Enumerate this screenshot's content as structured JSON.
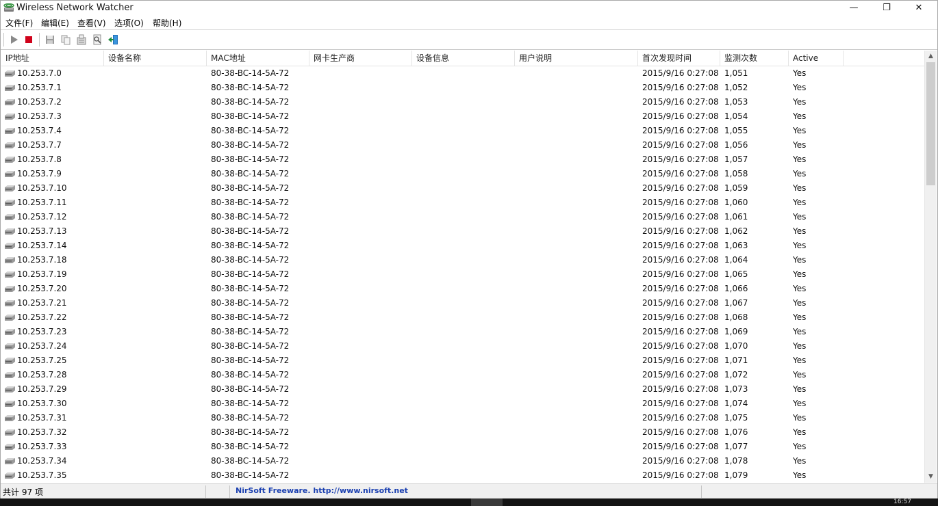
{
  "window": {
    "title": "Wireless Network Watcher",
    "controls": {
      "minimize": "—",
      "maximize": "❐",
      "close": "✕"
    }
  },
  "menu": [
    "文件(F)",
    "编辑(E)",
    "查看(V)",
    "选项(O)",
    "帮助(H)"
  ],
  "toolbar": {
    "buttons": [
      "start-scan-icon",
      "stop-scan-icon",
      "save-icon",
      "copy-icon",
      "properties-icon",
      "html-report-icon",
      "exit-icon"
    ]
  },
  "columns": [
    "IP地址",
    "设备名称",
    "MAC地址",
    "网卡生产商",
    "设备信息",
    "用户说明",
    "首次发现时间",
    "监测次数",
    "Active"
  ],
  "rows": [
    {
      "ip": "10.253.7.0",
      "name": "",
      "mac": "80-38-BC-14-5A-72",
      "vendor": "",
      "info": "",
      "note": "",
      "first": "2015/9/16 0:27:08",
      "count": "1,051",
      "active": "Yes"
    },
    {
      "ip": "10.253.7.1",
      "name": "",
      "mac": "80-38-BC-14-5A-72",
      "vendor": "",
      "info": "",
      "note": "",
      "first": "2015/9/16 0:27:08",
      "count": "1,052",
      "active": "Yes"
    },
    {
      "ip": "10.253.7.2",
      "name": "",
      "mac": "80-38-BC-14-5A-72",
      "vendor": "",
      "info": "",
      "note": "",
      "first": "2015/9/16 0:27:08",
      "count": "1,053",
      "active": "Yes"
    },
    {
      "ip": "10.253.7.3",
      "name": "",
      "mac": "80-38-BC-14-5A-72",
      "vendor": "",
      "info": "",
      "note": "",
      "first": "2015/9/16 0:27:08",
      "count": "1,054",
      "active": "Yes"
    },
    {
      "ip": "10.253.7.4",
      "name": "",
      "mac": "80-38-BC-14-5A-72",
      "vendor": "",
      "info": "",
      "note": "",
      "first": "2015/9/16 0:27:08",
      "count": "1,055",
      "active": "Yes"
    },
    {
      "ip": "10.253.7.7",
      "name": "",
      "mac": "80-38-BC-14-5A-72",
      "vendor": "",
      "info": "",
      "note": "",
      "first": "2015/9/16 0:27:08",
      "count": "1,056",
      "active": "Yes"
    },
    {
      "ip": "10.253.7.8",
      "name": "",
      "mac": "80-38-BC-14-5A-72",
      "vendor": "",
      "info": "",
      "note": "",
      "first": "2015/9/16 0:27:08",
      "count": "1,057",
      "active": "Yes"
    },
    {
      "ip": "10.253.7.9",
      "name": "",
      "mac": "80-38-BC-14-5A-72",
      "vendor": "",
      "info": "",
      "note": "",
      "first": "2015/9/16 0:27:08",
      "count": "1,058",
      "active": "Yes"
    },
    {
      "ip": "10.253.7.10",
      "name": "",
      "mac": "80-38-BC-14-5A-72",
      "vendor": "",
      "info": "",
      "note": "",
      "first": "2015/9/16 0:27:08",
      "count": "1,059",
      "active": "Yes"
    },
    {
      "ip": "10.253.7.11",
      "name": "",
      "mac": "80-38-BC-14-5A-72",
      "vendor": "",
      "info": "",
      "note": "",
      "first": "2015/9/16 0:27:08",
      "count": "1,060",
      "active": "Yes"
    },
    {
      "ip": "10.253.7.12",
      "name": "",
      "mac": "80-38-BC-14-5A-72",
      "vendor": "",
      "info": "",
      "note": "",
      "first": "2015/9/16 0:27:08",
      "count": "1,061",
      "active": "Yes"
    },
    {
      "ip": "10.253.7.13",
      "name": "",
      "mac": "80-38-BC-14-5A-72",
      "vendor": "",
      "info": "",
      "note": "",
      "first": "2015/9/16 0:27:08",
      "count": "1,062",
      "active": "Yes"
    },
    {
      "ip": "10.253.7.14",
      "name": "",
      "mac": "80-38-BC-14-5A-72",
      "vendor": "",
      "info": "",
      "note": "",
      "first": "2015/9/16 0:27:08",
      "count": "1,063",
      "active": "Yes"
    },
    {
      "ip": "10.253.7.18",
      "name": "",
      "mac": "80-38-BC-14-5A-72",
      "vendor": "",
      "info": "",
      "note": "",
      "first": "2015/9/16 0:27:08",
      "count": "1,064",
      "active": "Yes"
    },
    {
      "ip": "10.253.7.19",
      "name": "",
      "mac": "80-38-BC-14-5A-72",
      "vendor": "",
      "info": "",
      "note": "",
      "first": "2015/9/16 0:27:08",
      "count": "1,065",
      "active": "Yes"
    },
    {
      "ip": "10.253.7.20",
      "name": "",
      "mac": "80-38-BC-14-5A-72",
      "vendor": "",
      "info": "",
      "note": "",
      "first": "2015/9/16 0:27:08",
      "count": "1,066",
      "active": "Yes"
    },
    {
      "ip": "10.253.7.21",
      "name": "",
      "mac": "80-38-BC-14-5A-72",
      "vendor": "",
      "info": "",
      "note": "",
      "first": "2015/9/16 0:27:08",
      "count": "1,067",
      "active": "Yes"
    },
    {
      "ip": "10.253.7.22",
      "name": "",
      "mac": "80-38-BC-14-5A-72",
      "vendor": "",
      "info": "",
      "note": "",
      "first": "2015/9/16 0:27:08",
      "count": "1,068",
      "active": "Yes"
    },
    {
      "ip": "10.253.7.23",
      "name": "",
      "mac": "80-38-BC-14-5A-72",
      "vendor": "",
      "info": "",
      "note": "",
      "first": "2015/9/16 0:27:08",
      "count": "1,069",
      "active": "Yes"
    },
    {
      "ip": "10.253.7.24",
      "name": "",
      "mac": "80-38-BC-14-5A-72",
      "vendor": "",
      "info": "",
      "note": "",
      "first": "2015/9/16 0:27:08",
      "count": "1,070",
      "active": "Yes"
    },
    {
      "ip": "10.253.7.25",
      "name": "",
      "mac": "80-38-BC-14-5A-72",
      "vendor": "",
      "info": "",
      "note": "",
      "first": "2015/9/16 0:27:08",
      "count": "1,071",
      "active": "Yes"
    },
    {
      "ip": "10.253.7.28",
      "name": "",
      "mac": "80-38-BC-14-5A-72",
      "vendor": "",
      "info": "",
      "note": "",
      "first": "2015/9/16 0:27:08",
      "count": "1,072",
      "active": "Yes"
    },
    {
      "ip": "10.253.7.29",
      "name": "",
      "mac": "80-38-BC-14-5A-72",
      "vendor": "",
      "info": "",
      "note": "",
      "first": "2015/9/16 0:27:08",
      "count": "1,073",
      "active": "Yes"
    },
    {
      "ip": "10.253.7.30",
      "name": "",
      "mac": "80-38-BC-14-5A-72",
      "vendor": "",
      "info": "",
      "note": "",
      "first": "2015/9/16 0:27:08",
      "count": "1,074",
      "active": "Yes"
    },
    {
      "ip": "10.253.7.31",
      "name": "",
      "mac": "80-38-BC-14-5A-72",
      "vendor": "",
      "info": "",
      "note": "",
      "first": "2015/9/16 0:27:08",
      "count": "1,075",
      "active": "Yes"
    },
    {
      "ip": "10.253.7.32",
      "name": "",
      "mac": "80-38-BC-14-5A-72",
      "vendor": "",
      "info": "",
      "note": "",
      "first": "2015/9/16 0:27:08",
      "count": "1,076",
      "active": "Yes"
    },
    {
      "ip": "10.253.7.33",
      "name": "",
      "mac": "80-38-BC-14-5A-72",
      "vendor": "",
      "info": "",
      "note": "",
      "first": "2015/9/16 0:27:08",
      "count": "1,077",
      "active": "Yes"
    },
    {
      "ip": "10.253.7.34",
      "name": "",
      "mac": "80-38-BC-14-5A-72",
      "vendor": "",
      "info": "",
      "note": "",
      "first": "2015/9/16 0:27:08",
      "count": "1,078",
      "active": "Yes"
    },
    {
      "ip": "10.253.7.35",
      "name": "",
      "mac": "80-38-BC-14-5A-72",
      "vendor": "",
      "info": "",
      "note": "",
      "first": "2015/9/16 0:27:08",
      "count": "1,079",
      "active": "Yes"
    }
  ],
  "status": {
    "count": "共计 97 项",
    "link": "NirSoft Freeware.  http://www.nirsoft.net"
  },
  "taskbar": {
    "clock": "16:57"
  },
  "colors": {
    "link": "#1a3fb0",
    "stop": "#d0021b",
    "play": "#8a8a8a"
  }
}
